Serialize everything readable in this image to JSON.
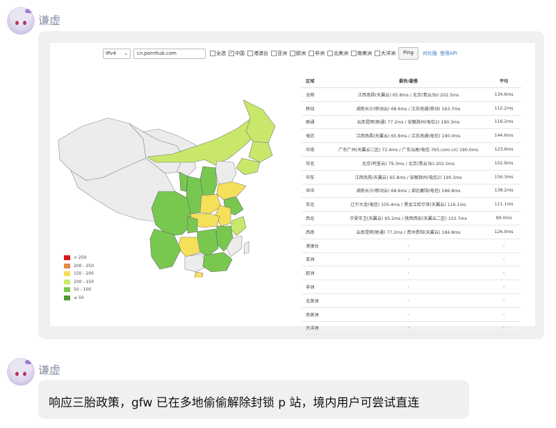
{
  "messages": [
    {
      "sender": "谦虚"
    },
    {
      "sender": "谦虚",
      "text": "响应三胎政策，gfw 已在多地偷偷解除封锁 p 站，境内用户可尝试直连"
    }
  ],
  "tool": {
    "ip_version": "IPv4",
    "url_value": "cn.pornhub.com",
    "regions": [
      {
        "label": "全选",
        "checked": false
      },
      {
        "label": "中国",
        "checked": true
      },
      {
        "label": "港澳台",
        "checked": false
      },
      {
        "label": "亚洲",
        "checked": false
      },
      {
        "label": "欧洲",
        "checked": false
      },
      {
        "label": "非洲",
        "checked": false
      },
      {
        "label": "北美洲",
        "checked": false
      },
      {
        "label": "南美洲",
        "checked": false
      },
      {
        "label": "大洋洲",
        "checked": false
      }
    ],
    "ping_label": "Ping",
    "link_compare": "对比版",
    "link_api": "使用API"
  },
  "legend": [
    {
      "label": "> 250",
      "color": "#d7191c"
    },
    {
      "label": "200 - 250",
      "color": "#e38b45"
    },
    {
      "label": "150 - 200",
      "color": "#f5e05a"
    },
    {
      "label": "100 - 150",
      "color": "#c9e86b"
    },
    {
      "label": "50 - 100",
      "color": "#78c850"
    },
    {
      "label": "≤ 50",
      "color": "#4a9a35"
    }
  ],
  "table": {
    "headers": [
      "区域",
      "最快/最慢",
      "平均"
    ],
    "rows": [
      [
        "全网",
        "江西南昌(天翼云) 65.8ms / 北京(青云3b) 202.5ms",
        "134.6ms"
      ],
      [
        "移动",
        "湖南长沙(移动云) 68.6ms / 江苏南通(移动) 163.7ms",
        "112.2ms"
      ],
      [
        "联通",
        "云南昆明(联通) 77.2ms / 安徽滁州(电信2) 190.3ms",
        "116.2ms"
      ],
      [
        "电信",
        "江西南昌(天翼云) 65.8ms / 江苏南通(电信) 190.0ms",
        "144.6ms"
      ],
      [
        "华南",
        "广东广州(天翼云二区) 72.4ms / 广东汕尾(电信-765.com.cn) 190.0ms",
        "123.6ms"
      ],
      [
        "华北",
        "北京(阿里云) 79.3ms / 北京(青云3b) 202.5ms",
        "102.9ms"
      ],
      [
        "华东",
        "江西南昌(天翼云) 65.8ms / 安徽滁州(电信2) 190.3ms",
        "156.3ms"
      ],
      [
        "华中",
        "湖南长沙(移动云) 68.6ms / 湖北襄阳(电信) 186.8ms",
        "138.2ms"
      ],
      [
        "东北",
        "辽宁大连(电信) 105.4ms / 黑龙江哈尔滨(天翼云) 116.1ms",
        "111.1ms"
      ],
      [
        "西北",
        "宁夏中卫(天翼云) 95.2ms / 陕西西安(天翼云二区) 102.7ms",
        "99.0ms"
      ],
      [
        "西南",
        "云南昆明(联通) 77.2ms / 贵州贵阳(天翼云) 184.8ms",
        "126.9ms"
      ],
      [
        "港澳台",
        "-",
        "-"
      ],
      [
        "亚洲",
        "-",
        "-"
      ],
      [
        "欧洲",
        "-",
        "-"
      ],
      [
        "非洲",
        "-",
        "-"
      ],
      [
        "北美洲",
        "-",
        "-"
      ],
      [
        "南美洲",
        "-",
        "-"
      ],
      [
        "大洋洲",
        "-",
        "-"
      ]
    ]
  }
}
